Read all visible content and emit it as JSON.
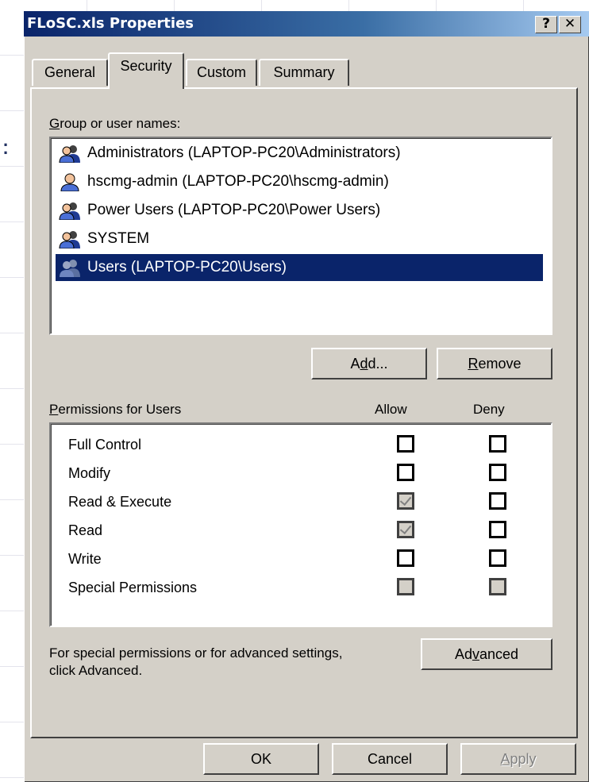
{
  "window": {
    "title": "FLoSC.xls Properties",
    "help_glyph": "?",
    "close_glyph": "✕"
  },
  "tabs": [
    {
      "label": "General",
      "active": false
    },
    {
      "label": "Security",
      "active": true
    },
    {
      "label": "Custom",
      "active": false
    },
    {
      "label": "Summary",
      "active": false
    }
  ],
  "groups": {
    "label": "Group or user names:",
    "items": [
      {
        "label": "Administrators (LAPTOP-PC20\\Administrators)",
        "selected": false
      },
      {
        "label": "hscmg-admin (LAPTOP-PC20\\hscmg-admin)",
        "selected": false
      },
      {
        "label": "Power Users (LAPTOP-PC20\\Power Users)",
        "selected": false
      },
      {
        "label": "SYSTEM",
        "selected": false
      },
      {
        "label": "Users (LAPTOP-PC20\\Users)",
        "selected": true
      }
    ],
    "add_label": "Add...",
    "remove_label": "Remove"
  },
  "permissions": {
    "label": "Permissions for Users",
    "allow_header": "Allow",
    "deny_header": "Deny",
    "rows": [
      {
        "name": "Full Control",
        "allow": "unchecked",
        "deny": "unchecked"
      },
      {
        "name": "Modify",
        "allow": "unchecked",
        "deny": "unchecked"
      },
      {
        "name": "Read & Execute",
        "allow": "checked-disabled",
        "deny": "unchecked"
      },
      {
        "name": "Read",
        "allow": "checked-disabled",
        "deny": "unchecked"
      },
      {
        "name": "Write",
        "allow": "unchecked",
        "deny": "unchecked"
      },
      {
        "name": "Special Permissions",
        "allow": "disabled",
        "deny": "disabled"
      }
    ]
  },
  "advanced": {
    "hint_line1": "For special permissions or for advanced settings,",
    "hint_line2": "click Advanced.",
    "button_label": "Advanced"
  },
  "footer": {
    "ok_label": "OK",
    "cancel_label": "Cancel",
    "apply_label": "Apply"
  },
  "colors": {
    "face": "#d4d0c8",
    "title_start": "#0a246a",
    "title_end": "#a6caf0",
    "selection": "#0a246a"
  }
}
